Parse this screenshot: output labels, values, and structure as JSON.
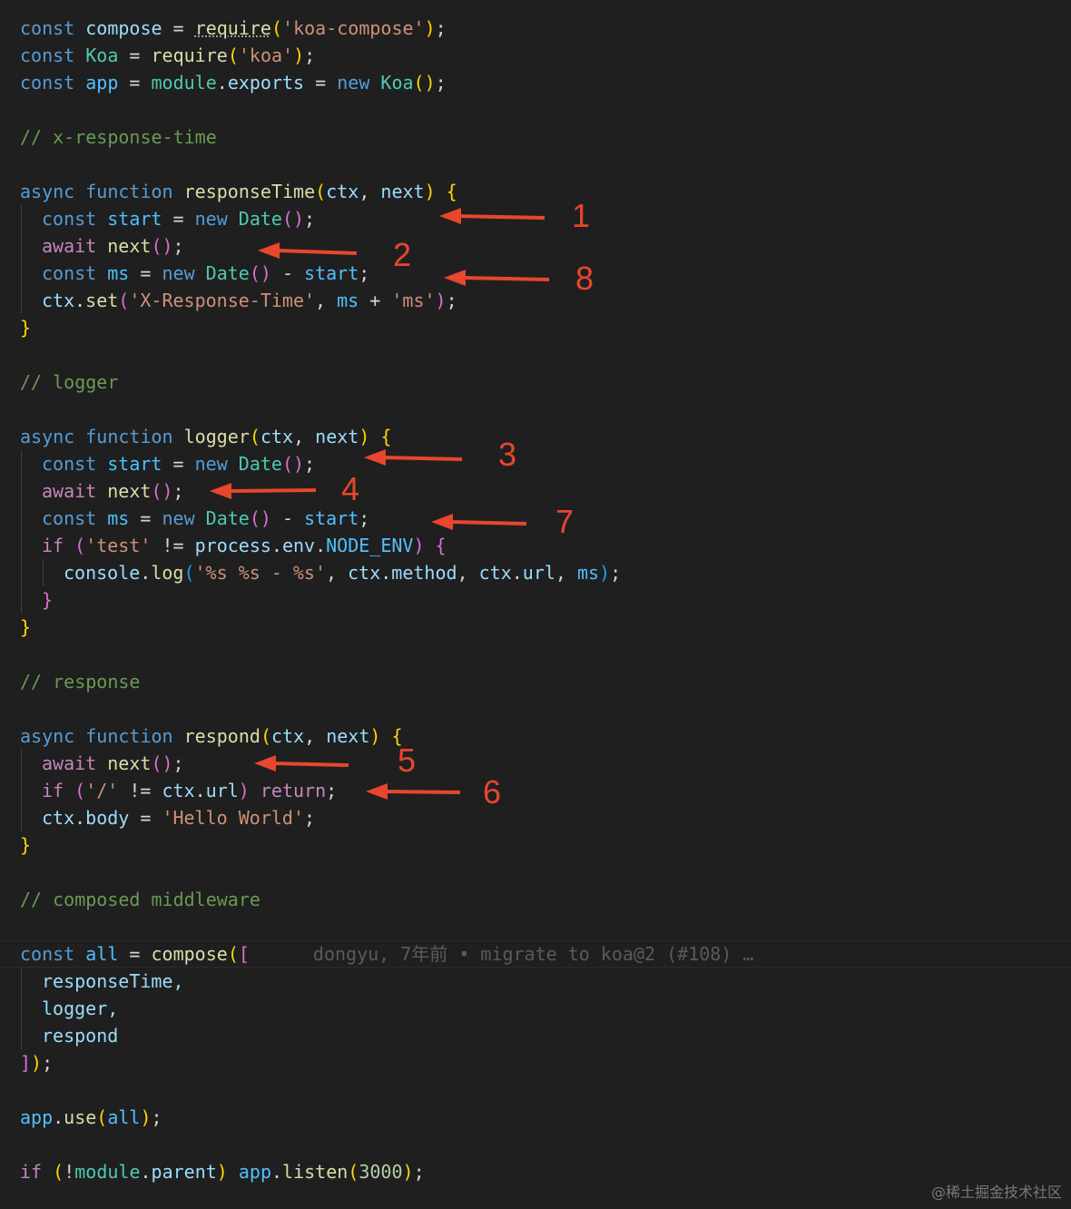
{
  "code": {
    "l1": {
      "a": "const",
      "b": "compose",
      "c": "require",
      "d": "'koa-compose'"
    },
    "l2": {
      "a": "const",
      "b": "Koa",
      "c": "require",
      "d": "'koa'"
    },
    "l3": {
      "a": "const",
      "b": "app",
      "c": "module",
      "d": "exports",
      "e": "new",
      "f": "Koa"
    },
    "c1": "// x-response-time",
    "f1": {
      "a": "async",
      "b": "function",
      "c": "responseTime",
      "d": "ctx",
      "e": "next"
    },
    "f1l1": {
      "a": "const",
      "b": "start",
      "c": "new",
      "d": "Date"
    },
    "f1l2": {
      "a": "await",
      "b": "next"
    },
    "f1l3": {
      "a": "const",
      "b": "ms",
      "c": "new",
      "d": "Date",
      "e": "start"
    },
    "f1l4": {
      "a": "ctx",
      "b": "set",
      "c": "'X-Response-Time'",
      "d": "ms",
      "e": "'ms'"
    },
    "c2": "// logger",
    "f2": {
      "a": "async",
      "b": "function",
      "c": "logger",
      "d": "ctx",
      "e": "next"
    },
    "f2l1": {
      "a": "const",
      "b": "start",
      "c": "new",
      "d": "Date"
    },
    "f2l2": {
      "a": "await",
      "b": "next"
    },
    "f2l3": {
      "a": "const",
      "b": "ms",
      "c": "new",
      "d": "Date",
      "e": "start"
    },
    "f2l4": {
      "a": "if",
      "b": "'test'",
      "c": "process",
      "d": "env",
      "e": "NODE_ENV"
    },
    "f2l5": {
      "a": "console",
      "b": "log",
      "c": "'%s %s - %s'",
      "d": "ctx",
      "e": "method",
      "f": "ctx",
      "g": "url",
      "h": "ms"
    },
    "c3": "// response",
    "f3": {
      "a": "async",
      "b": "function",
      "c": "respond",
      "d": "ctx",
      "e": "next"
    },
    "f3l1": {
      "a": "await",
      "b": "next"
    },
    "f3l2": {
      "a": "if",
      "b": "'/'",
      "c": "ctx",
      "d": "url",
      "e": "return"
    },
    "f3l3": {
      "a": "ctx",
      "b": "body",
      "c": "'Hello World'"
    },
    "c4": "// composed middleware",
    "all": {
      "a": "const",
      "b": "all",
      "c": "compose",
      "blame": "dongyu, 7年前 • migrate to koa@2 (#108) …"
    },
    "arr": [
      "responseTime,",
      "logger,",
      "respond"
    ],
    "use": {
      "a": "app",
      "b": "use",
      "c": "all"
    },
    "listen": {
      "a": "if",
      "b": "module",
      "c": "parent",
      "d": "app",
      "e": "listen",
      "f": "3000"
    }
  },
  "annotations": [
    "1",
    "2",
    "8",
    "3",
    "4",
    "7",
    "5",
    "6"
  ],
  "annotation_color": "#e8462d",
  "watermark": "@稀土掘金技术社区"
}
